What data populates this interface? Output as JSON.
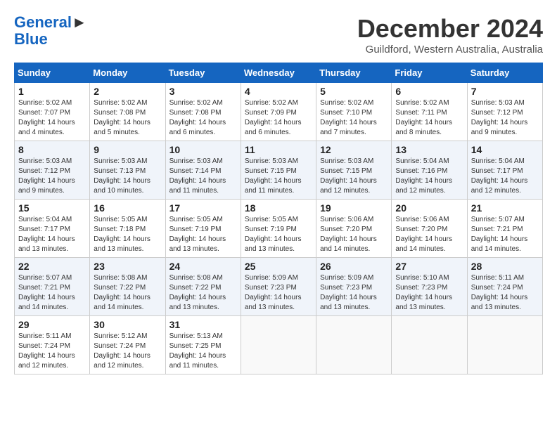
{
  "header": {
    "logo_line1": "General",
    "logo_line2": "Blue",
    "month_title": "December 2024",
    "location": "Guildford, Western Australia, Australia"
  },
  "calendar": {
    "days_of_week": [
      "Sunday",
      "Monday",
      "Tuesday",
      "Wednesday",
      "Thursday",
      "Friday",
      "Saturday"
    ],
    "weeks": [
      [
        {
          "day": "",
          "info": ""
        },
        {
          "day": "2",
          "info": "Sunrise: 5:02 AM\nSunset: 7:08 PM\nDaylight: 14 hours and 5 minutes."
        },
        {
          "day": "3",
          "info": "Sunrise: 5:02 AM\nSunset: 7:08 PM\nDaylight: 14 hours and 6 minutes."
        },
        {
          "day": "4",
          "info": "Sunrise: 5:02 AM\nSunset: 7:09 PM\nDaylight: 14 hours and 6 minutes."
        },
        {
          "day": "5",
          "info": "Sunrise: 5:02 AM\nSunset: 7:10 PM\nDaylight: 14 hours and 7 minutes."
        },
        {
          "day": "6",
          "info": "Sunrise: 5:02 AM\nSunset: 7:11 PM\nDaylight: 14 hours and 8 minutes."
        },
        {
          "day": "7",
          "info": "Sunrise: 5:03 AM\nSunset: 7:12 PM\nDaylight: 14 hours and 9 minutes."
        }
      ],
      [
        {
          "day": "8",
          "info": "Sunrise: 5:03 AM\nSunset: 7:12 PM\nDaylight: 14 hours and 9 minutes."
        },
        {
          "day": "9",
          "info": "Sunrise: 5:03 AM\nSunset: 7:13 PM\nDaylight: 14 hours and 10 minutes."
        },
        {
          "day": "10",
          "info": "Sunrise: 5:03 AM\nSunset: 7:14 PM\nDaylight: 14 hours and 11 minutes."
        },
        {
          "day": "11",
          "info": "Sunrise: 5:03 AM\nSunset: 7:15 PM\nDaylight: 14 hours and 11 minutes."
        },
        {
          "day": "12",
          "info": "Sunrise: 5:03 AM\nSunset: 7:15 PM\nDaylight: 14 hours and 12 minutes."
        },
        {
          "day": "13",
          "info": "Sunrise: 5:04 AM\nSunset: 7:16 PM\nDaylight: 14 hours and 12 minutes."
        },
        {
          "day": "14",
          "info": "Sunrise: 5:04 AM\nSunset: 7:17 PM\nDaylight: 14 hours and 12 minutes."
        }
      ],
      [
        {
          "day": "15",
          "info": "Sunrise: 5:04 AM\nSunset: 7:17 PM\nDaylight: 14 hours and 13 minutes."
        },
        {
          "day": "16",
          "info": "Sunrise: 5:05 AM\nSunset: 7:18 PM\nDaylight: 14 hours and 13 minutes."
        },
        {
          "day": "17",
          "info": "Sunrise: 5:05 AM\nSunset: 7:19 PM\nDaylight: 14 hours and 13 minutes."
        },
        {
          "day": "18",
          "info": "Sunrise: 5:05 AM\nSunset: 7:19 PM\nDaylight: 14 hours and 13 minutes."
        },
        {
          "day": "19",
          "info": "Sunrise: 5:06 AM\nSunset: 7:20 PM\nDaylight: 14 hours and 14 minutes."
        },
        {
          "day": "20",
          "info": "Sunrise: 5:06 AM\nSunset: 7:20 PM\nDaylight: 14 hours and 14 minutes."
        },
        {
          "day": "21",
          "info": "Sunrise: 5:07 AM\nSunset: 7:21 PM\nDaylight: 14 hours and 14 minutes."
        }
      ],
      [
        {
          "day": "22",
          "info": "Sunrise: 5:07 AM\nSunset: 7:21 PM\nDaylight: 14 hours and 14 minutes."
        },
        {
          "day": "23",
          "info": "Sunrise: 5:08 AM\nSunset: 7:22 PM\nDaylight: 14 hours and 14 minutes."
        },
        {
          "day": "24",
          "info": "Sunrise: 5:08 AM\nSunset: 7:22 PM\nDaylight: 14 hours and 13 minutes."
        },
        {
          "day": "25",
          "info": "Sunrise: 5:09 AM\nSunset: 7:23 PM\nDaylight: 14 hours and 13 minutes."
        },
        {
          "day": "26",
          "info": "Sunrise: 5:09 AM\nSunset: 7:23 PM\nDaylight: 14 hours and 13 minutes."
        },
        {
          "day": "27",
          "info": "Sunrise: 5:10 AM\nSunset: 7:23 PM\nDaylight: 14 hours and 13 minutes."
        },
        {
          "day": "28",
          "info": "Sunrise: 5:11 AM\nSunset: 7:24 PM\nDaylight: 14 hours and 13 minutes."
        }
      ],
      [
        {
          "day": "29",
          "info": "Sunrise: 5:11 AM\nSunset: 7:24 PM\nDaylight: 14 hours and 12 minutes."
        },
        {
          "day": "30",
          "info": "Sunrise: 5:12 AM\nSunset: 7:24 PM\nDaylight: 14 hours and 12 minutes."
        },
        {
          "day": "31",
          "info": "Sunrise: 5:13 AM\nSunset: 7:25 PM\nDaylight: 14 hours and 11 minutes."
        },
        {
          "day": "",
          "info": ""
        },
        {
          "day": "",
          "info": ""
        },
        {
          "day": "",
          "info": ""
        },
        {
          "day": "",
          "info": ""
        }
      ]
    ],
    "first_week_sunday": {
      "day": "1",
      "info": "Sunrise: 5:02 AM\nSunset: 7:07 PM\nDaylight: 14 hours and 4 minutes."
    }
  }
}
